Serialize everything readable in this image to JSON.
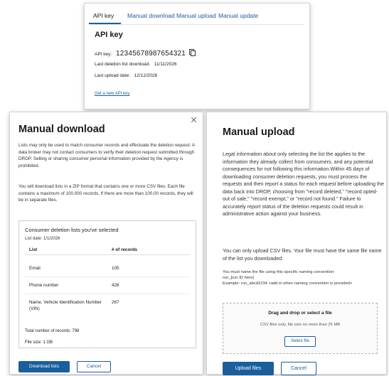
{
  "api_panel": {
    "tabs": [
      {
        "label": "API key",
        "active": true
      },
      {
        "label": "Manual download",
        "active": false
      },
      {
        "label": "Manual upload",
        "active": false
      },
      {
        "label": "Manual update",
        "active": false
      }
    ],
    "title": "API key",
    "api_key_label": "API key:",
    "api_key_value": "12345678987654321",
    "last_download_label": "Last deletion list download:",
    "last_download_value": "11/11/2026",
    "last_update_label": "Last upload date:",
    "last_update_value": "12/12/2026",
    "new_key_link": "Get a new API key"
  },
  "download_panel": {
    "title": "Manual download",
    "para1": "Lists may only be used to match consumer records and effectuate the deletion request. A data broker may not contact consumers to verify their deletion request submitted through DROP. Selling or sharing consumer personal information provided by the Agency is prohibited.",
    "para2": "You will download lists in a ZIP format that contains one or more CSV files. Each file contains a maximum of 100,000 records. If there are more than 100,00 records, they will be in separate files.",
    "box_heading": "Consumer deletion lists you've selected",
    "list_date": "List date: 1/1/2026",
    "columns": [
      "List",
      "# of records"
    ],
    "rows": [
      {
        "list": "Email",
        "records": "105"
      },
      {
        "list": "Phone number",
        "records": "426"
      },
      {
        "list": "Name, Vehicle Identification Number (VIN)",
        "records": "267"
      }
    ],
    "total": "Total number of records: 798",
    "file_size": "File size: 1 GB",
    "download_label": "Download lists",
    "cancel_label": "Cancel"
  },
  "upload_panel": {
    "title": "Manual upload",
    "para1": "Legal information about only selecting the list the applies to the information they already collect from consumers, and any potential consequences for not following this information.Within 45 days of downloading consumer deletion requests, you must process the requests and then report a status for each request before uploading the data back into DROP, choosing from \"record deleted,\" \"record opted-out of sale,\" \"record exempt,\" or \"record not found.\" Failure to accurately report status of the deletion requests could result in administrative action against your business.",
    "para2": "You can only upload CSV files. Your file must have the same file name of the list you downloaded.",
    "naming_line1": "You must name the file using this specific naming convention:",
    "naming_line2": "run_[run ID here]",
    "naming_line3": "Example: run_abcd1234 <add in when naming convention is provided>",
    "drop_title": "Drag and drop or select a file",
    "drop_hint": "CSV files only, file size no more than 25 MB",
    "select_label": "Select file",
    "upload_label": "Upload files",
    "cancel_label": "Cancel"
  }
}
